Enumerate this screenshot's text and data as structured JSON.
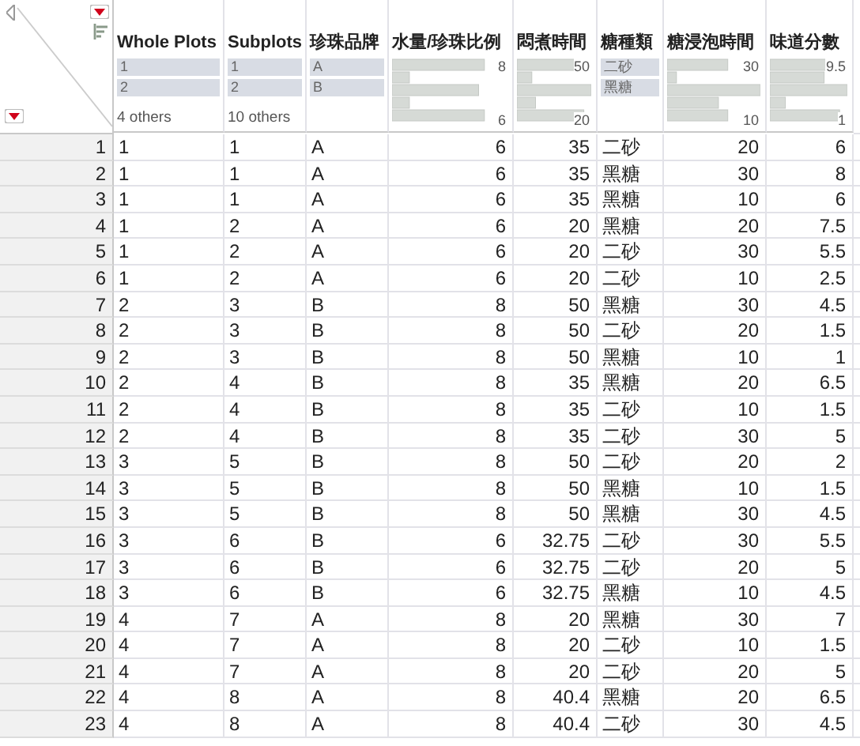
{
  "columns": [
    {
      "name": "Whole Plots",
      "kind": "categorical",
      "top_levels": [
        "1",
        "2"
      ],
      "others": "4 others"
    },
    {
      "name": "Subplots",
      "kind": "categorical",
      "top_levels": [
        "1",
        "2"
      ],
      "others": "10 others"
    },
    {
      "name": "珍珠品牌",
      "kind": "categorical",
      "top_levels": [
        "A",
        "B"
      ]
    },
    {
      "name": "水量/珍珠比例",
      "kind": "continuous",
      "max": "8",
      "min": "6"
    },
    {
      "name": "悶煮時間",
      "kind": "continuous",
      "max": "50",
      "min": "20"
    },
    {
      "name": "糖種類",
      "kind": "categorical",
      "top_levels": [
        "二砂",
        "黑糖"
      ]
    },
    {
      "name": "糖浸泡時間",
      "kind": "continuous",
      "max": "30",
      "min": "10"
    },
    {
      "name": "味道分數",
      "kind": "continuous",
      "max": "9.5",
      "min": "1"
    }
  ],
  "rows": [
    {
      "number": "1",
      "cells": [
        "1",
        "1",
        "A",
        "6",
        "35",
        "二砂",
        "20",
        "6"
      ]
    },
    {
      "number": "2",
      "cells": [
        "1",
        "1",
        "A",
        "6",
        "35",
        "黑糖",
        "30",
        "8"
      ]
    },
    {
      "number": "3",
      "cells": [
        "1",
        "1",
        "A",
        "6",
        "35",
        "黑糖",
        "10",
        "6"
      ]
    },
    {
      "number": "4",
      "cells": [
        "1",
        "2",
        "A",
        "6",
        "20",
        "黑糖",
        "20",
        "7.5"
      ]
    },
    {
      "number": "5",
      "cells": [
        "1",
        "2",
        "A",
        "6",
        "20",
        "二砂",
        "30",
        "5.5"
      ]
    },
    {
      "number": "6",
      "cells": [
        "1",
        "2",
        "A",
        "6",
        "20",
        "二砂",
        "10",
        "2.5"
      ]
    },
    {
      "number": "7",
      "cells": [
        "2",
        "3",
        "B",
        "8",
        "50",
        "黑糖",
        "30",
        "4.5"
      ]
    },
    {
      "number": "8",
      "cells": [
        "2",
        "3",
        "B",
        "8",
        "50",
        "二砂",
        "20",
        "1.5"
      ]
    },
    {
      "number": "9",
      "cells": [
        "2",
        "3",
        "B",
        "8",
        "50",
        "黑糖",
        "10",
        "1"
      ]
    },
    {
      "number": "10",
      "cells": [
        "2",
        "4",
        "B",
        "8",
        "35",
        "黑糖",
        "20",
        "6.5"
      ]
    },
    {
      "number": "11",
      "cells": [
        "2",
        "4",
        "B",
        "8",
        "35",
        "二砂",
        "10",
        "1.5"
      ]
    },
    {
      "number": "12",
      "cells": [
        "2",
        "4",
        "B",
        "8",
        "35",
        "二砂",
        "30",
        "5"
      ]
    },
    {
      "number": "13",
      "cells": [
        "3",
        "5",
        "B",
        "8",
        "50",
        "二砂",
        "20",
        "2"
      ]
    },
    {
      "number": "14",
      "cells": [
        "3",
        "5",
        "B",
        "8",
        "50",
        "黑糖",
        "10",
        "1.5"
      ]
    },
    {
      "number": "15",
      "cells": [
        "3",
        "5",
        "B",
        "8",
        "50",
        "黑糖",
        "30",
        "4.5"
      ]
    },
    {
      "number": "16",
      "cells": [
        "3",
        "6",
        "B",
        "6",
        "32.75",
        "二砂",
        "30",
        "5.5"
      ]
    },
    {
      "number": "17",
      "cells": [
        "3",
        "6",
        "B",
        "6",
        "32.75",
        "二砂",
        "20",
        "5"
      ]
    },
    {
      "number": "18",
      "cells": [
        "3",
        "6",
        "B",
        "6",
        "32.75",
        "黑糖",
        "10",
        "4.5"
      ]
    },
    {
      "number": "19",
      "cells": [
        "4",
        "7",
        "A",
        "8",
        "20",
        "黑糖",
        "30",
        "7"
      ]
    },
    {
      "number": "20",
      "cells": [
        "4",
        "7",
        "A",
        "8",
        "20",
        "二砂",
        "10",
        "1.5"
      ]
    },
    {
      "number": "21",
      "cells": [
        "4",
        "7",
        "A",
        "8",
        "20",
        "二砂",
        "20",
        "5"
      ]
    },
    {
      "number": "22",
      "cells": [
        "4",
        "8",
        "A",
        "8",
        "40.4",
        "黑糖",
        "20",
        "6.5"
      ]
    },
    {
      "number": "23",
      "cells": [
        "4",
        "8",
        "A",
        "8",
        "40.4",
        "二砂",
        "30",
        "4.5"
      ]
    }
  ]
}
